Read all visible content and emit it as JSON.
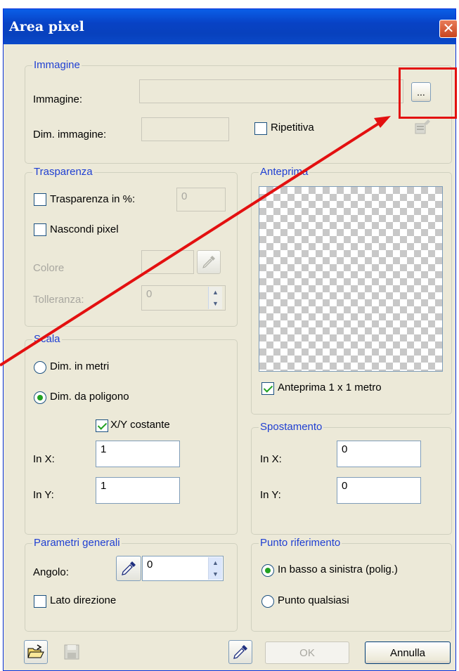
{
  "window": {
    "title": "Area pixel",
    "close_label": "✕"
  },
  "immagine": {
    "legend": "Immagine",
    "image_label": "Immagine:",
    "image_value": "",
    "browse_label": "...",
    "dim_label": "Dim. immagine:",
    "dim_value": "",
    "ripetitiva_label": "Ripetitiva",
    "ripetitiva_checked": false
  },
  "trasparenza": {
    "legend": "Trasparenza",
    "percent_label": "Trasparenza in %:",
    "percent_value": "0",
    "nascondi_label": "Nascondi pixel",
    "colore_label": "Colore",
    "tolleranza_label": "Tolleranza:",
    "tolleranza_value": "0"
  },
  "anteprima": {
    "legend": "Anteprima",
    "check_label": "Anteprima 1 x 1 metro",
    "checked": true
  },
  "scala": {
    "legend": "Scala",
    "option_metri": "Dim. in metri",
    "option_poligono": "Dim. da poligono",
    "selected": "Dim. da poligono",
    "costante_label": "X/Y costante",
    "costante_checked": true,
    "in_x_label": "In X:",
    "in_x_value": "1",
    "in_y_label": "In Y:",
    "in_y_value": "1"
  },
  "spostamento": {
    "legend": "Spostamento",
    "in_x_label": "In X:",
    "in_x_value": "0",
    "in_y_label": "In Y:",
    "in_y_value": "0"
  },
  "parametri": {
    "legend": "Parametri generali",
    "angolo_label": "Angolo:",
    "angolo_value": "0",
    "lato_label": "Lato direzione"
  },
  "punto": {
    "legend": "Punto riferimento",
    "option_basso": "In basso a sinistra (polig.)",
    "option_qualsiasi": "Punto qualsiasi",
    "selected": "In basso a sinistra (polig.)"
  },
  "footer": {
    "ok_label": "OK",
    "annulla_label": "Annulla"
  },
  "icons": {
    "open": "folder-open-icon",
    "save": "save-icon",
    "pick": "eyedropper-icon",
    "props": "properties-icon"
  },
  "colors": {
    "annotation": "#e31010",
    "legend": "#1f3fd2",
    "checkmark": "#21a121"
  }
}
